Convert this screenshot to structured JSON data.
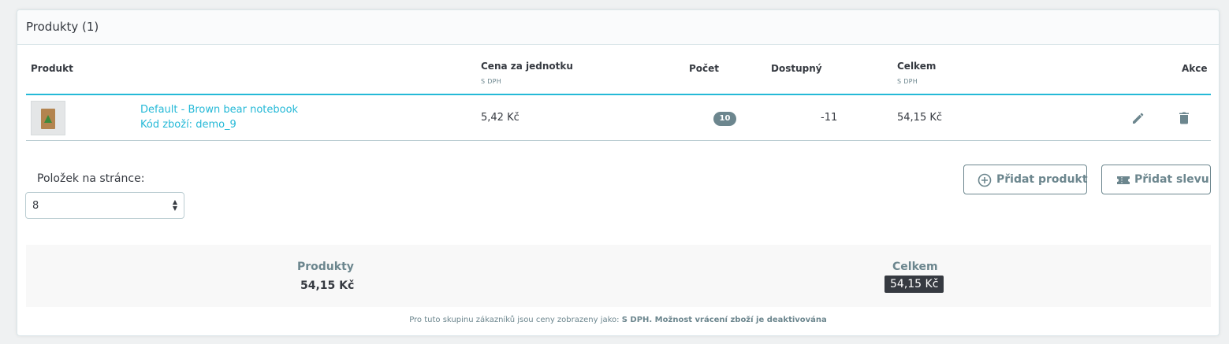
{
  "card": {
    "title": "Produkty (1)"
  },
  "table": {
    "headers": {
      "product": "Produkt",
      "unit_price": "Cena za jednotku",
      "unit_price_sub": "S DPH",
      "quantity": "Počet",
      "available": "Dostupný",
      "total": "Celkem",
      "total_sub": "S DPH",
      "actions": "Akce"
    },
    "rows": [
      {
        "name": "Default - Brown bear notebook",
        "reference": "Kód zboží: demo_9",
        "unit_price": "5,42 Kč",
        "quantity": "10",
        "available": "-11",
        "total": "54,15 Kč",
        "actions": [
          "pencil-icon",
          "trash-icon"
        ]
      }
    ]
  },
  "pagination": {
    "label": "Položek na stránce:",
    "selected": "8"
  },
  "buttons": {
    "add_product": "Přidat produkt",
    "add_discount": "Přidat slevu"
  },
  "summary": {
    "products_label": "Produkty",
    "products_value": "54,15 Kč",
    "total_label": "Celkem",
    "total_value": "54,15 Kč"
  },
  "footnote": {
    "prefix": "Pro tuto skupinu zákazníků jsou ceny zobrazeny jako:",
    "bold": "S DPH. Možnost vrácení zboží je deaktivována"
  },
  "colors": {
    "accent": "#25b9d7",
    "text": "#363a41",
    "muted": "#6c868e"
  }
}
